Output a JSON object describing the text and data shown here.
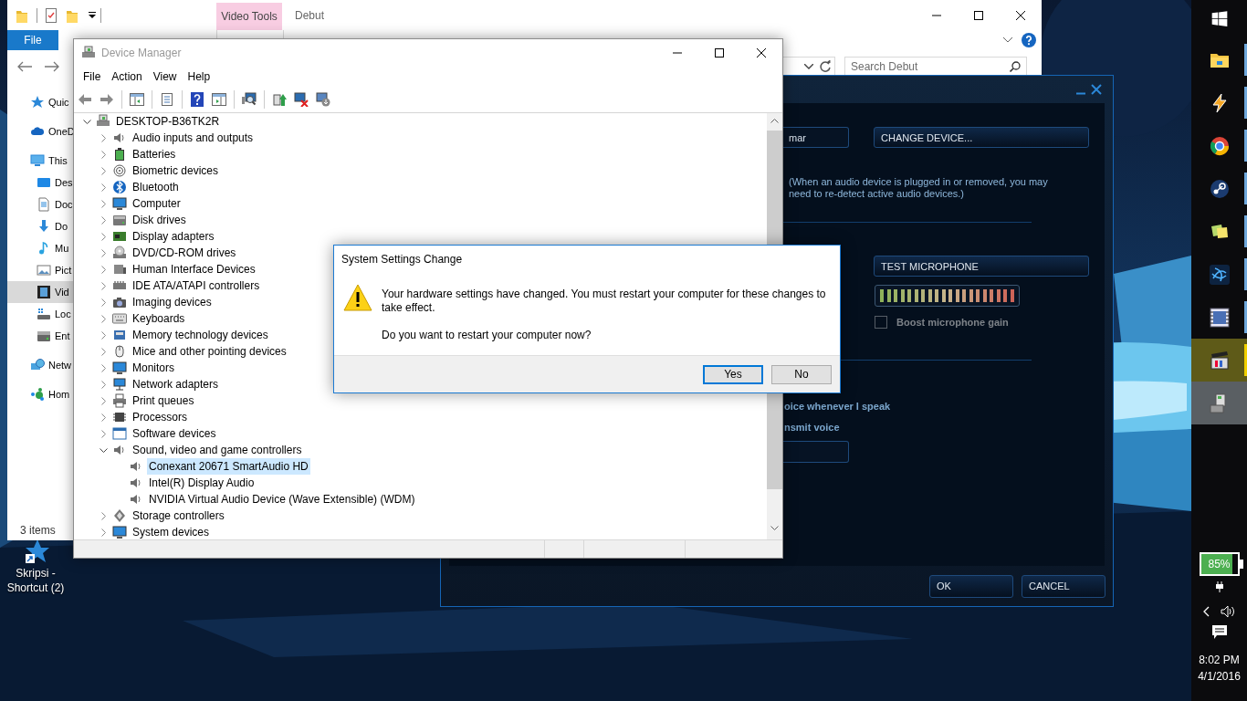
{
  "desktop": {
    "icons": [
      {
        "label": "Skripsi - Shortcut (2)"
      }
    ]
  },
  "explorer": {
    "context_group": "Video Tools",
    "title": "Debut",
    "ribbon_tabs": [
      {
        "label": "File",
        "kind": "file"
      }
    ],
    "search": {
      "placeholder": "Search Debut"
    },
    "nav_pane": [
      {
        "label": "Quic",
        "kind": "quick",
        "selected": false
      },
      {
        "label": "OneD",
        "kind": "cloud",
        "selected": false
      },
      {
        "label": "This",
        "kind": "pc",
        "selected": false,
        "children": [
          {
            "label": "Des",
            "kind": "desktop",
            "selected": false
          },
          {
            "label": "Doc",
            "kind": "documents",
            "selected": false
          },
          {
            "label": "Do",
            "kind": "downloads",
            "selected": false
          },
          {
            "label": "Mu",
            "kind": "music",
            "selected": false
          },
          {
            "label": "Pict",
            "kind": "pictures",
            "selected": false
          },
          {
            "label": "Vid",
            "kind": "videos",
            "selected": true
          },
          {
            "label": "Loc",
            "kind": "local_disk",
            "selected": false
          },
          {
            "label": "Ent",
            "kind": "drive",
            "selected": false
          }
        ]
      },
      {
        "label": "Netw",
        "kind": "network",
        "selected": false
      },
      {
        "label": "Hom",
        "kind": "homegroup",
        "selected": false
      }
    ],
    "status": "3 items"
  },
  "audio_app": {
    "device_field": "mar",
    "change_device": "CHANGE DEVICE...",
    "note": "(When an audio device is plugged in or removed, you may need to re-detect active audio devices.)",
    "test_button": "TEST MICROPHONE",
    "boost": {
      "label": "Boost microphone gain",
      "checked": false
    },
    "voice_options": [
      "oice whenever I speak",
      "nsmit voice"
    ],
    "buttons": [
      "OK",
      "CANCEL"
    ]
  },
  "device_manager": {
    "title": "Device Manager",
    "menu": [
      "File",
      "Action",
      "View",
      "Help"
    ],
    "tree": {
      "label": "DESKTOP-B36TK2R",
      "kind": "pc",
      "expanded": true,
      "selected": false,
      "children": [
        {
          "label": "Audio inputs and outputs",
          "kind": "audio",
          "expanded": false,
          "selected": false
        },
        {
          "label": "Batteries",
          "kind": "battery",
          "expanded": false,
          "selected": false
        },
        {
          "label": "Biometric devices",
          "kind": "biometric",
          "expanded": false,
          "selected": false
        },
        {
          "label": "Bluetooth",
          "kind": "bluetooth",
          "expanded": false,
          "selected": false
        },
        {
          "label": "Computer",
          "kind": "computer",
          "expanded": false,
          "selected": false
        },
        {
          "label": "Disk drives",
          "kind": "disk",
          "expanded": false,
          "selected": false
        },
        {
          "label": "Display adapters",
          "kind": "display",
          "expanded": false,
          "selected": false
        },
        {
          "label": "DVD/CD-ROM drives",
          "kind": "dvd",
          "expanded": false,
          "selected": false
        },
        {
          "label": "Human Interface Devices",
          "kind": "hid",
          "expanded": false,
          "selected": false
        },
        {
          "label": "IDE ATA/ATAPI controllers",
          "kind": "ide",
          "expanded": false,
          "selected": false
        },
        {
          "label": "Imaging devices",
          "kind": "imaging",
          "expanded": false,
          "selected": false
        },
        {
          "label": "Keyboards",
          "kind": "keyboard",
          "expanded": false,
          "selected": false
        },
        {
          "label": "Memory technology devices",
          "kind": "memory",
          "expanded": false,
          "selected": false
        },
        {
          "label": "Mice and other pointing devices",
          "kind": "mouse",
          "expanded": false,
          "selected": false
        },
        {
          "label": "Monitors",
          "kind": "computer",
          "expanded": false,
          "selected": false
        },
        {
          "label": "Network adapters",
          "kind": "network",
          "expanded": false,
          "selected": false
        },
        {
          "label": "Print queues",
          "kind": "printer",
          "expanded": false,
          "selected": false
        },
        {
          "label": "Processors",
          "kind": "processor",
          "expanded": false,
          "selected": false
        },
        {
          "label": "Software devices",
          "kind": "software",
          "expanded": false,
          "selected": false
        },
        {
          "label": "Sound, video and game controllers",
          "kind": "audio",
          "expanded": true,
          "selected": false,
          "children": [
            {
              "label": "Conexant 20671 SmartAudio HD",
              "kind": "audio",
              "selected": true
            },
            {
              "label": "Intel(R) Display Audio",
              "kind": "audio",
              "selected": false
            },
            {
              "label": "NVIDIA Virtual Audio Device (Wave Extensible) (WDM)",
              "kind": "audio",
              "selected": false
            }
          ]
        },
        {
          "label": "Storage controllers",
          "kind": "storage",
          "expanded": false,
          "selected": false
        },
        {
          "label": "System devices",
          "kind": "computer",
          "expanded": false,
          "selected": false
        }
      ]
    }
  },
  "dialog": {
    "title": "System Settings Change",
    "message": "Your hardware settings have changed. You must restart your computer for these changes to take effect.",
    "question": "Do you want to restart your computer now?",
    "buttons": [
      {
        "label": "Yes",
        "default": true
      },
      {
        "label": "No",
        "default": false
      }
    ]
  },
  "taskbar": {
    "apps": [
      {
        "kind": "start"
      },
      {
        "kind": "folder",
        "running": true,
        "attention": false,
        "active": false
      },
      {
        "kind": "bolt",
        "running": true,
        "attention": false,
        "active": false
      },
      {
        "kind": "circle",
        "running": true,
        "attention": false,
        "active": false
      },
      {
        "kind": "round",
        "running": true,
        "attention": false,
        "active": false
      },
      {
        "kind": "notes",
        "running": true,
        "attention": false,
        "active": false
      },
      {
        "kind": "swirl",
        "running": true,
        "attention": false,
        "active": false
      },
      {
        "kind": "film",
        "running": true,
        "attention": false,
        "active": false
      },
      {
        "kind": "clapper",
        "running": true,
        "attention": true,
        "active": false
      },
      {
        "kind": "device",
        "running": false,
        "attention": false,
        "active": true
      }
    ],
    "battery": {
      "label": "85%",
      "level": 0.85
    },
    "clock": {
      "time": "8:02 PM",
      "date": "4/1/2016"
    }
  }
}
